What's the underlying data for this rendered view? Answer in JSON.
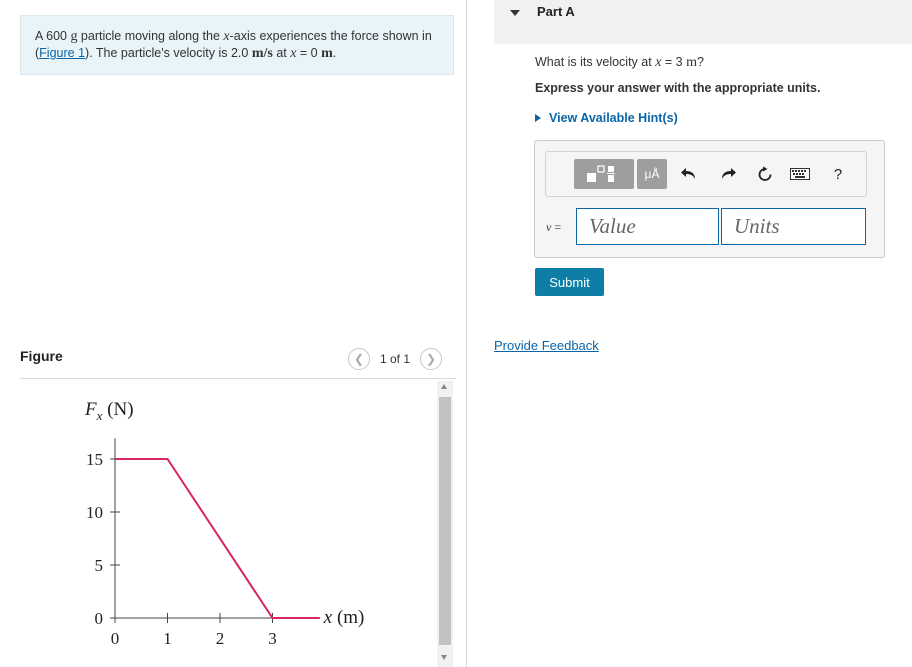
{
  "problem": {
    "text_before": "A 600 ",
    "unit_g": "g",
    "text_mid1": " particle moving along the ",
    "var_x": "x",
    "text_mid2": "-axis experiences the force shown in (",
    "figure_link": "Figure 1",
    "text_mid3": "). The particle's velocity is 2.0 ",
    "unit_ms": "m/s",
    "text_mid4": " at ",
    "var_x2": "x",
    "text_mid5": " = 0 ",
    "unit_m": "m",
    "text_end": "."
  },
  "figure": {
    "label": "Figure",
    "pager_text": "1 of 1",
    "prev_icon": "chevron-left-icon",
    "next_icon": "chevron-right-icon"
  },
  "chart_data": {
    "type": "line",
    "title": "",
    "ylabel_var": "F",
    "ylabel_sub": "x",
    "ylabel_unit": " (N)",
    "xlabel_var": "x",
    "xlabel_unit": " (m)",
    "x_ticks": [
      "0",
      "1",
      "2",
      "3"
    ],
    "y_ticks": [
      "0",
      "5",
      "10",
      "15"
    ],
    "xlim": [
      0,
      3.9
    ],
    "ylim": [
      0,
      16
    ],
    "series": [
      {
        "points": [
          [
            0,
            15
          ],
          [
            1,
            15
          ],
          [
            3,
            0
          ],
          [
            3.9,
            0
          ]
        ],
        "color": "#d6285a"
      }
    ]
  },
  "part": {
    "title": "Part A",
    "question_pre": "What is its velocity at ",
    "question_var": "x",
    "question_val": " = 3 ",
    "question_unit": "m",
    "question_end": "?",
    "instruction": "Express your answer with the appropriate units.",
    "hint_label": "View Available Hint(s)"
  },
  "answer": {
    "var_label": "v",
    "eq": " =",
    "value_placeholder": "Value",
    "units_placeholder": "Units",
    "units_btn": "μÅ",
    "help_label": "?",
    "submit_label": "Submit"
  },
  "feedback_label": "Provide Feedback",
  "colors": {
    "accent": "#0a66a8",
    "submit": "#0e7ea6",
    "problem_bg": "#e8f4f8",
    "curve": "#d6285a"
  }
}
